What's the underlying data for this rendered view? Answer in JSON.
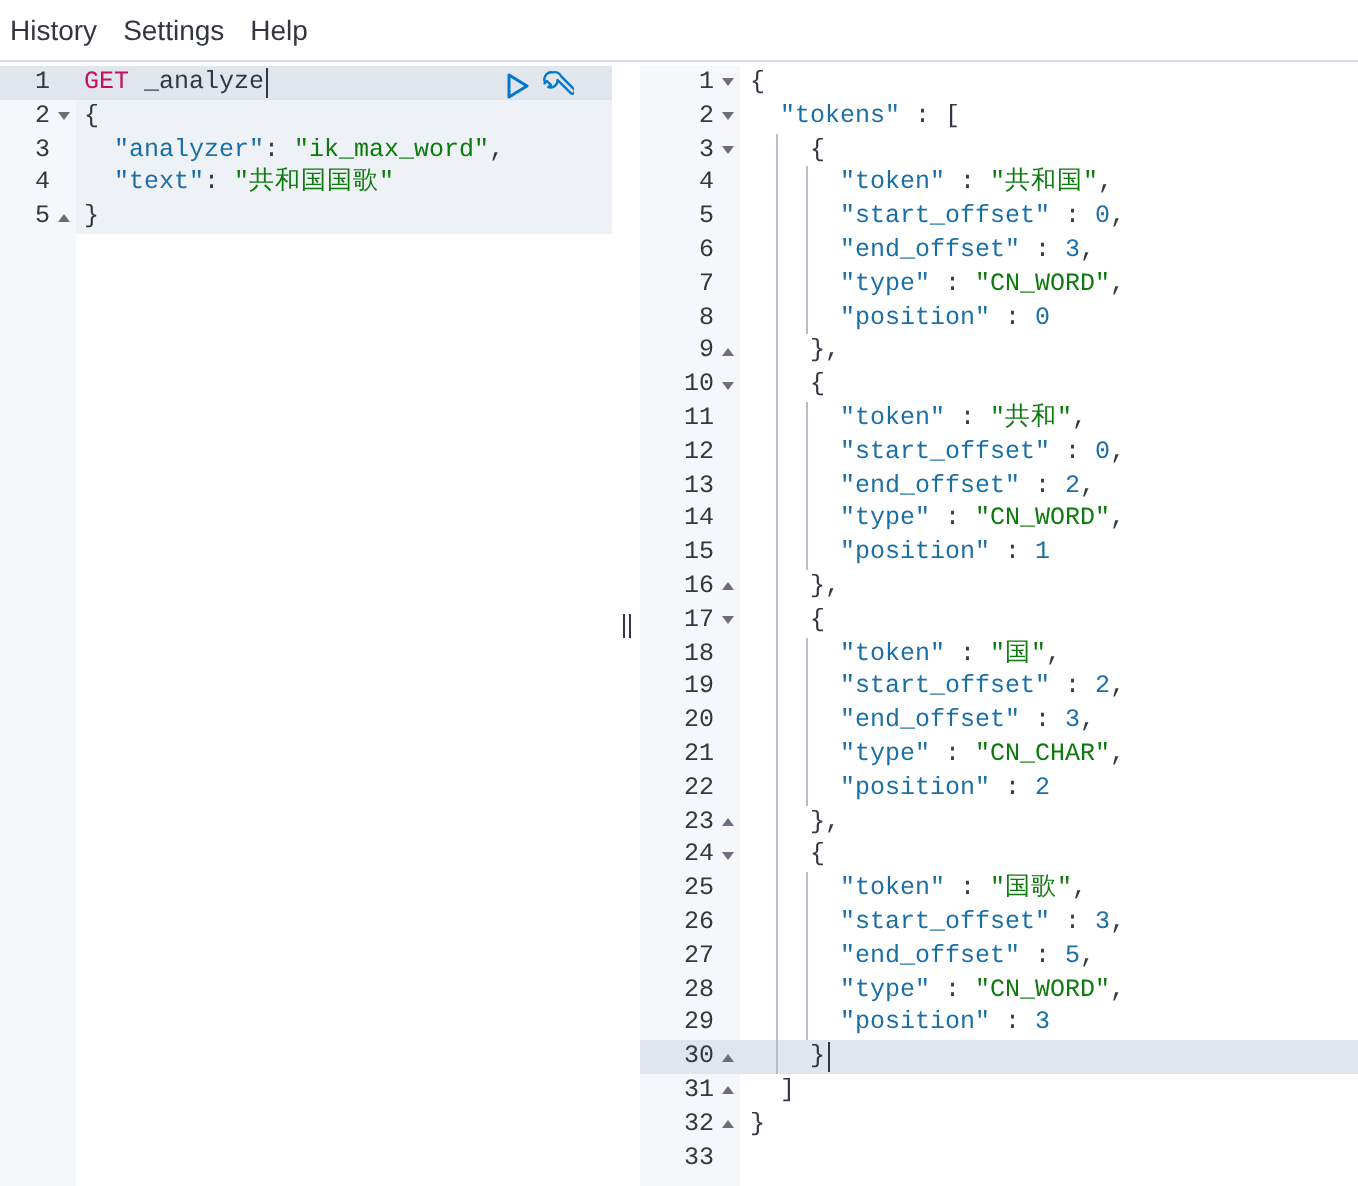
{
  "menu": [
    "History",
    "Settings",
    "Help"
  ],
  "request": {
    "lines": [
      {
        "number": "1",
        "fold_start": false,
        "fold_end": false,
        "active": true,
        "highlighted": true,
        "cursor": true,
        "tokens": [
          {
            "text": "GET",
            "kind": "method"
          },
          {
            "text": " _analyze",
            "kind": "plain"
          }
        ]
      },
      {
        "number": "2",
        "fold_start": true,
        "fold_end": false,
        "active": false,
        "highlighted": true,
        "cursor": false,
        "tokens": [
          {
            "text": "{",
            "kind": "open"
          }
        ]
      },
      {
        "number": "3",
        "fold_start": false,
        "fold_end": false,
        "active": false,
        "highlighted": true,
        "cursor": false,
        "tokens": [
          {
            "text": "\"analyzer\"",
            "kind": "key"
          },
          {
            "text": ": ",
            "kind": "punct"
          },
          {
            "text": "\"ik_max_word\"",
            "kind": "string"
          },
          {
            "text": ",",
            "kind": "punct"
          }
        ]
      },
      {
        "number": "4",
        "fold_start": false,
        "fold_end": false,
        "active": false,
        "highlighted": true,
        "cursor": false,
        "tokens": [
          {
            "text": "\"text\"",
            "kind": "key"
          },
          {
            "text": ": ",
            "kind": "punct"
          },
          {
            "text": "\"共和国国歌\"",
            "kind": "string"
          }
        ]
      },
      {
        "number": "5",
        "fold_start": false,
        "fold_end": true,
        "active": false,
        "highlighted": true,
        "cursor": false,
        "tokens": [
          {
            "text": "}",
            "kind": "close"
          }
        ]
      }
    ]
  },
  "response": {
    "lines": [
      {
        "number": "1",
        "fold_start": true,
        "fold_end": false,
        "active": false,
        "cursor": false,
        "tokens": [
          {
            "text": "{",
            "kind": "open"
          }
        ]
      },
      {
        "number": "2",
        "fold_start": true,
        "fold_end": false,
        "active": false,
        "cursor": false,
        "tokens": [
          {
            "text": "\"tokens\"",
            "kind": "key"
          },
          {
            "text": " : ",
            "kind": "punct"
          },
          {
            "text": "[",
            "kind": "open"
          }
        ]
      },
      {
        "number": "3",
        "fold_start": true,
        "fold_end": false,
        "active": false,
        "cursor": false,
        "tokens": [
          {
            "text": "{",
            "kind": "open"
          }
        ]
      },
      {
        "number": "4",
        "fold_start": false,
        "fold_end": false,
        "active": false,
        "cursor": false,
        "tokens": [
          {
            "text": "\"token\"",
            "kind": "key"
          },
          {
            "text": " : ",
            "kind": "punct"
          },
          {
            "text": "\"共和国\"",
            "kind": "string"
          },
          {
            "text": ",",
            "kind": "punct"
          }
        ]
      },
      {
        "number": "5",
        "fold_start": false,
        "fold_end": false,
        "active": false,
        "cursor": false,
        "tokens": [
          {
            "text": "\"start_offset\"",
            "kind": "key"
          },
          {
            "text": " : ",
            "kind": "punct"
          },
          {
            "text": "0",
            "kind": "number"
          },
          {
            "text": ",",
            "kind": "punct"
          }
        ]
      },
      {
        "number": "6",
        "fold_start": false,
        "fold_end": false,
        "active": false,
        "cursor": false,
        "tokens": [
          {
            "text": "\"end_offset\"",
            "kind": "key"
          },
          {
            "text": " : ",
            "kind": "punct"
          },
          {
            "text": "3",
            "kind": "number"
          },
          {
            "text": ",",
            "kind": "punct"
          }
        ]
      },
      {
        "number": "7",
        "fold_start": false,
        "fold_end": false,
        "active": false,
        "cursor": false,
        "tokens": [
          {
            "text": "\"type\"",
            "kind": "key"
          },
          {
            "text": " : ",
            "kind": "punct"
          },
          {
            "text": "\"CN_WORD\"",
            "kind": "string"
          },
          {
            "text": ",",
            "kind": "punct"
          }
        ]
      },
      {
        "number": "8",
        "fold_start": false,
        "fold_end": false,
        "active": false,
        "cursor": false,
        "tokens": [
          {
            "text": "\"position\"",
            "kind": "key"
          },
          {
            "text": " : ",
            "kind": "punct"
          },
          {
            "text": "0",
            "kind": "number"
          }
        ]
      },
      {
        "number": "9",
        "fold_start": false,
        "fold_end": true,
        "active": false,
        "cursor": false,
        "tokens": [
          {
            "text": "}",
            "kind": "close"
          },
          {
            "text": ",",
            "kind": "punct"
          }
        ]
      },
      {
        "number": "10",
        "fold_start": true,
        "fold_end": false,
        "active": false,
        "cursor": false,
        "tokens": [
          {
            "text": "{",
            "kind": "open"
          }
        ]
      },
      {
        "number": "11",
        "fold_start": false,
        "fold_end": false,
        "active": false,
        "cursor": false,
        "tokens": [
          {
            "text": "\"token\"",
            "kind": "key"
          },
          {
            "text": " : ",
            "kind": "punct"
          },
          {
            "text": "\"共和\"",
            "kind": "string"
          },
          {
            "text": ",",
            "kind": "punct"
          }
        ]
      },
      {
        "number": "12",
        "fold_start": false,
        "fold_end": false,
        "active": false,
        "cursor": false,
        "tokens": [
          {
            "text": "\"start_offset\"",
            "kind": "key"
          },
          {
            "text": " : ",
            "kind": "punct"
          },
          {
            "text": "0",
            "kind": "number"
          },
          {
            "text": ",",
            "kind": "punct"
          }
        ]
      },
      {
        "number": "13",
        "fold_start": false,
        "fold_end": false,
        "active": false,
        "cursor": false,
        "tokens": [
          {
            "text": "\"end_offset\"",
            "kind": "key"
          },
          {
            "text": " : ",
            "kind": "punct"
          },
          {
            "text": "2",
            "kind": "number"
          },
          {
            "text": ",",
            "kind": "punct"
          }
        ]
      },
      {
        "number": "14",
        "fold_start": false,
        "fold_end": false,
        "active": false,
        "cursor": false,
        "tokens": [
          {
            "text": "\"type\"",
            "kind": "key"
          },
          {
            "text": " : ",
            "kind": "punct"
          },
          {
            "text": "\"CN_WORD\"",
            "kind": "string"
          },
          {
            "text": ",",
            "kind": "punct"
          }
        ]
      },
      {
        "number": "15",
        "fold_start": false,
        "fold_end": false,
        "active": false,
        "cursor": false,
        "tokens": [
          {
            "text": "\"position\"",
            "kind": "key"
          },
          {
            "text": " : ",
            "kind": "punct"
          },
          {
            "text": "1",
            "kind": "number"
          }
        ]
      },
      {
        "number": "16",
        "fold_start": false,
        "fold_end": true,
        "active": false,
        "cursor": false,
        "tokens": [
          {
            "text": "}",
            "kind": "close"
          },
          {
            "text": ",",
            "kind": "punct"
          }
        ]
      },
      {
        "number": "17",
        "fold_start": true,
        "fold_end": false,
        "active": false,
        "cursor": false,
        "tokens": [
          {
            "text": "{",
            "kind": "open"
          }
        ]
      },
      {
        "number": "18",
        "fold_start": false,
        "fold_end": false,
        "active": false,
        "cursor": false,
        "tokens": [
          {
            "text": "\"token\"",
            "kind": "key"
          },
          {
            "text": " : ",
            "kind": "punct"
          },
          {
            "text": "\"国\"",
            "kind": "string"
          },
          {
            "text": ",",
            "kind": "punct"
          }
        ]
      },
      {
        "number": "19",
        "fold_start": false,
        "fold_end": false,
        "active": false,
        "cursor": false,
        "tokens": [
          {
            "text": "\"start_offset\"",
            "kind": "key"
          },
          {
            "text": " : ",
            "kind": "punct"
          },
          {
            "text": "2",
            "kind": "number"
          },
          {
            "text": ",",
            "kind": "punct"
          }
        ]
      },
      {
        "number": "20",
        "fold_start": false,
        "fold_end": false,
        "active": false,
        "cursor": false,
        "tokens": [
          {
            "text": "\"end_offset\"",
            "kind": "key"
          },
          {
            "text": " : ",
            "kind": "punct"
          },
          {
            "text": "3",
            "kind": "number"
          },
          {
            "text": ",",
            "kind": "punct"
          }
        ]
      },
      {
        "number": "21",
        "fold_start": false,
        "fold_end": false,
        "active": false,
        "cursor": false,
        "tokens": [
          {
            "text": "\"type\"",
            "kind": "key"
          },
          {
            "text": " : ",
            "kind": "punct"
          },
          {
            "text": "\"CN_CHAR\"",
            "kind": "string"
          },
          {
            "text": ",",
            "kind": "punct"
          }
        ]
      },
      {
        "number": "22",
        "fold_start": false,
        "fold_end": false,
        "active": false,
        "cursor": false,
        "tokens": [
          {
            "text": "\"position\"",
            "kind": "key"
          },
          {
            "text": " : ",
            "kind": "punct"
          },
          {
            "text": "2",
            "kind": "number"
          }
        ]
      },
      {
        "number": "23",
        "fold_start": false,
        "fold_end": true,
        "active": false,
        "cursor": false,
        "tokens": [
          {
            "text": "}",
            "kind": "close"
          },
          {
            "text": ",",
            "kind": "punct"
          }
        ]
      },
      {
        "number": "24",
        "fold_start": true,
        "fold_end": false,
        "active": false,
        "cursor": false,
        "tokens": [
          {
            "text": "{",
            "kind": "open"
          }
        ]
      },
      {
        "number": "25",
        "fold_start": false,
        "fold_end": false,
        "active": false,
        "cursor": false,
        "tokens": [
          {
            "text": "\"token\"",
            "kind": "key"
          },
          {
            "text": " : ",
            "kind": "punct"
          },
          {
            "text": "\"国歌\"",
            "kind": "string"
          },
          {
            "text": ",",
            "kind": "punct"
          }
        ]
      },
      {
        "number": "26",
        "fold_start": false,
        "fold_end": false,
        "active": false,
        "cursor": false,
        "tokens": [
          {
            "text": "\"start_offset\"",
            "kind": "key"
          },
          {
            "text": " : ",
            "kind": "punct"
          },
          {
            "text": "3",
            "kind": "number"
          },
          {
            "text": ",",
            "kind": "punct"
          }
        ]
      },
      {
        "number": "27",
        "fold_start": false,
        "fold_end": false,
        "active": false,
        "cursor": false,
        "tokens": [
          {
            "text": "\"end_offset\"",
            "kind": "key"
          },
          {
            "text": " : ",
            "kind": "punct"
          },
          {
            "text": "5",
            "kind": "number"
          },
          {
            "text": ",",
            "kind": "punct"
          }
        ]
      },
      {
        "number": "28",
        "fold_start": false,
        "fold_end": false,
        "active": false,
        "cursor": false,
        "tokens": [
          {
            "text": "\"type\"",
            "kind": "key"
          },
          {
            "text": " : ",
            "kind": "punct"
          },
          {
            "text": "\"CN_WORD\"",
            "kind": "string"
          },
          {
            "text": ",",
            "kind": "punct"
          }
        ]
      },
      {
        "number": "29",
        "fold_start": false,
        "fold_end": false,
        "active": false,
        "cursor": false,
        "tokens": [
          {
            "text": "\"position\"",
            "kind": "key"
          },
          {
            "text": " : ",
            "kind": "punct"
          },
          {
            "text": "3",
            "kind": "number"
          }
        ]
      },
      {
        "number": "30",
        "fold_start": false,
        "fold_end": true,
        "active": true,
        "cursor": true,
        "tokens": [
          {
            "text": "}",
            "kind": "close"
          }
        ]
      },
      {
        "number": "31",
        "fold_start": false,
        "fold_end": true,
        "active": false,
        "cursor": false,
        "tokens": [
          {
            "text": "]",
            "kind": "close"
          }
        ]
      },
      {
        "number": "32",
        "fold_start": false,
        "fold_end": true,
        "active": false,
        "cursor": false,
        "tokens": [
          {
            "text": "}",
            "kind": "close"
          }
        ]
      },
      {
        "number": "33",
        "fold_start": false,
        "fold_end": false,
        "active": false,
        "cursor": false
      }
    ]
  }
}
